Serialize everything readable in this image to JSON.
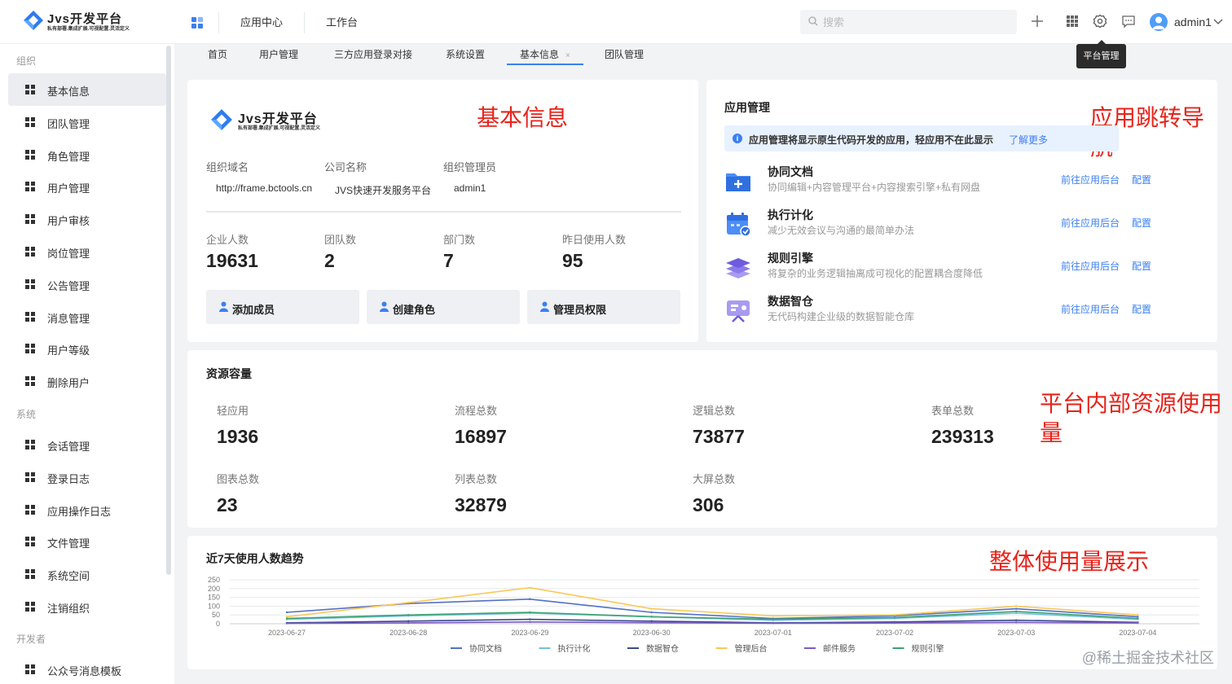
{
  "brand": {
    "title": "Jvs开发平台",
    "subtitle": "私有部署.集成扩展.可视配置.灵活定义",
    "logo_colors": [
      "#1f6fe5",
      "#4fa2ff"
    ]
  },
  "top_nav": {
    "items": [
      "应用中心",
      "工作台"
    ],
    "search_placeholder": "搜索",
    "tool_icons": [
      "plus-icon",
      "apps-grid-icon",
      "gear-icon",
      "message-icon"
    ],
    "username": "admin1",
    "tooltip": "平台管理"
  },
  "sidebar": {
    "groups": [
      {
        "label": "组织",
        "items": [
          "基本信息",
          "团队管理",
          "角色管理",
          "用户管理",
          "用户审核",
          "岗位管理",
          "公告管理",
          "消息管理",
          "用户等级",
          "删除用户"
        ]
      },
      {
        "label": "系统",
        "items": [
          "会话管理",
          "登录日志",
          "应用操作日志",
          "文件管理",
          "系统空间",
          "注销组织"
        ]
      },
      {
        "label": "开发者",
        "items": [
          "公众号消息模板"
        ]
      }
    ],
    "active_item": "基本信息"
  },
  "tabs": {
    "items": [
      "首页",
      "用户管理",
      "三方应用登录对接",
      "系统设置",
      "基本信息",
      "团队管理"
    ],
    "active": "基本信息",
    "close_glyph": "×"
  },
  "basic_info": {
    "annotation": "基本信息",
    "fields": [
      {
        "label": "组织域名",
        "value": "http://frame.bctools.cn"
      },
      {
        "label": "公司名称",
        "value": "JVS快速开发服务平台"
      },
      {
        "label": "组织管理员",
        "value": "admin1"
      }
    ],
    "stats": [
      {
        "label": "企业人数",
        "value": "19631"
      },
      {
        "label": "团队数",
        "value": "2"
      },
      {
        "label": "部门数",
        "value": "7"
      },
      {
        "label": "昨日使用人数",
        "value": "95"
      }
    ],
    "actions": [
      "添加成员",
      "创建角色",
      "管理员权限"
    ]
  },
  "app_management": {
    "title": "应用管理",
    "annotation": "应用跳转导航",
    "notice": "应用管理将显示原生代码开发的应用，轻应用不在此显示",
    "notice_link": "了解更多",
    "apps": [
      {
        "name": "协同文档",
        "desc": "协同编辑+内容管理平台+内容搜索引擎+私有网盘",
        "icon": "folder-plus-icon",
        "link": "前往应用后台",
        "config": "配置"
      },
      {
        "name": "执行计化",
        "desc": "减少无效会议与沟通的最简单办法",
        "icon": "calendar-check-icon",
        "link": "前往应用后台",
        "config": "配置"
      },
      {
        "name": "规则引擎",
        "desc": "将复杂的业务逻辑抽离成可视化的配置耦合度降低",
        "icon": "layers-icon",
        "link": "前往应用后台",
        "config": "配置"
      },
      {
        "name": "数据智仓",
        "desc": "无代码构建企业级的数据智能仓库",
        "icon": "data-screen-icon",
        "link": "前往应用后台",
        "config": "配置"
      }
    ]
  },
  "resources": {
    "title": "资源容量",
    "annotation": "平台内部资源使用量",
    "items": [
      {
        "label": "轻应用",
        "value": "1936"
      },
      {
        "label": "流程总数",
        "value": "16897"
      },
      {
        "label": "逻辑总数",
        "value": "73877"
      },
      {
        "label": "表单总数",
        "value": "239313"
      },
      {
        "label": "图表总数",
        "value": "23"
      },
      {
        "label": "列表总数",
        "value": "32879"
      },
      {
        "label": "大屏总数",
        "value": "306"
      }
    ]
  },
  "trend": {
    "title": "近7天使用人数趋势",
    "annotation": "整体使用量展示"
  },
  "chart_data": {
    "type": "line",
    "title": "近7天使用人数趋势",
    "x": [
      "2023-06-27",
      "2023-06-28",
      "2023-06-29",
      "2023-06-30",
      "2023-07-01",
      "2023-07-02",
      "2023-07-03",
      "2023-07-04"
    ],
    "ylim": [
      0,
      250
    ],
    "yticks": [
      0,
      50,
      100,
      150,
      200,
      250
    ],
    "grid": true,
    "legend_position": "bottom",
    "series": [
      {
        "name": "协同文档",
        "color": "#5470c6",
        "values": [
          65,
          115,
          140,
          65,
          30,
          45,
          85,
          40
        ]
      },
      {
        "name": "执行计化",
        "color": "#73c0de",
        "values": [
          25,
          45,
          60,
          40,
          20,
          30,
          60,
          25
        ]
      },
      {
        "name": "数据智仓",
        "color": "#3a4a8a",
        "values": [
          5,
          15,
          25,
          15,
          5,
          10,
          20,
          8
        ]
      },
      {
        "name": "管理后台",
        "color": "#fac858",
        "values": [
          40,
          120,
          205,
          85,
          45,
          50,
          100,
          50
        ]
      },
      {
        "name": "邮件服务",
        "color": "#7b5cc4",
        "values": [
          2,
          5,
          10,
          6,
          3,
          4,
          8,
          4
        ]
      },
      {
        "name": "规则引擎",
        "color": "#3ba272",
        "values": [
          30,
          50,
          65,
          40,
          25,
          35,
          70,
          30
        ]
      }
    ]
  },
  "watermark": "@稀土掘金技术社区",
  "colors": {
    "primary": "#3b7ff5",
    "annotation": "#e8231b"
  }
}
